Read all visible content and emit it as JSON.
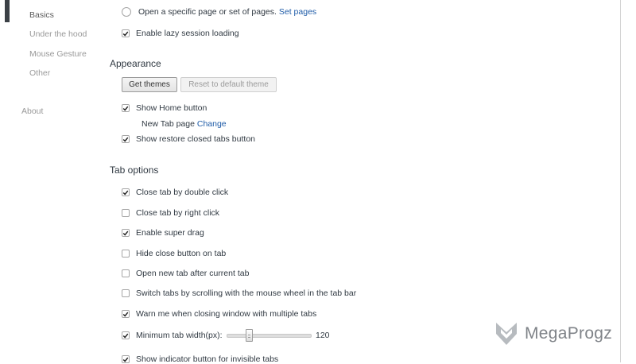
{
  "sidebar": {
    "items": [
      {
        "label": "Basics",
        "selected": true
      },
      {
        "label": "Under the hood"
      },
      {
        "label": "Mouse Gesture"
      },
      {
        "label": "Other"
      }
    ],
    "about_label": "About"
  },
  "startup": {
    "open_specific_label": "Open a specific page or set of pages.",
    "set_pages_link": "Set pages",
    "lazy_loading_label": "Enable lazy session loading",
    "lazy_loading_checked": true
  },
  "appearance": {
    "title": "Appearance",
    "get_themes_label": "Get themes",
    "reset_theme_label": "Reset to default theme",
    "show_home_label": "Show Home button",
    "show_home_checked": true,
    "new_tab_page_label": "New Tab page",
    "change_link": "Change",
    "show_restore_label": "Show restore closed tabs button",
    "show_restore_checked": true
  },
  "tab_options": {
    "title": "Tab options",
    "items": [
      {
        "label": "Close tab by double click",
        "checked": true
      },
      {
        "label": "Close tab by right click",
        "checked": false
      },
      {
        "label": "Enable super drag",
        "checked": true
      },
      {
        "label": "Hide close button on tab",
        "checked": false
      },
      {
        "label": "Open new tab after current tab",
        "checked": false
      },
      {
        "label": "Switch tabs by scrolling with the mouse wheel in the tab bar",
        "checked": false
      },
      {
        "label": "Warn me when closing window with multiple tabs",
        "checked": true
      },
      {
        "label": "Minimum tab width(px):",
        "checked": true
      },
      {
        "label": "Show indicator button for invisible tabs",
        "checked": true
      }
    ],
    "min_width_value": "120",
    "min_width_slider_fraction": 0.25
  },
  "watermark": {
    "text": "MegaProgz"
  },
  "colors": {
    "link": "#1f5ca8",
    "text": "#303942",
    "muted": "#999999"
  }
}
